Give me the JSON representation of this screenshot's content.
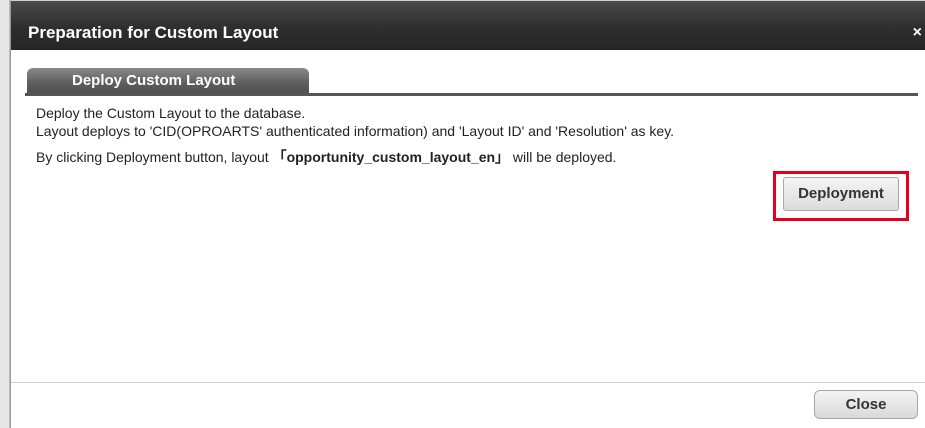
{
  "dialog": {
    "title": "Preparation for Custom Layout",
    "close_icon": "×"
  },
  "tab": {
    "label": "Deploy Custom Layout"
  },
  "content": {
    "line1": "Deploy the Custom Layout to the database.",
    "line2": "Layout deploys to 'CID(OPROARTS' authenticated information) and 'Layout ID' and 'Resolution' as key.",
    "line3_prefix": "By clicking Deployment button, layout ",
    "layout_name": "「opportunity_custom_layout_en」",
    "line3_suffix": " will be deployed."
  },
  "buttons": {
    "deploy_label": "Deployment",
    "close_label": "Close"
  },
  "colors": {
    "highlight": "#e2001a",
    "titlebar": "#2e2e2e",
    "tab": "#5d5d5d"
  }
}
